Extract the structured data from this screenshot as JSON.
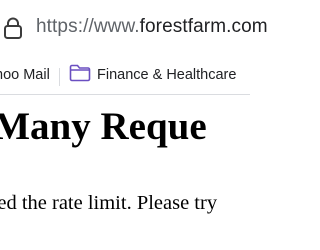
{
  "address_bar": {
    "prefix": "https://www.",
    "domain": "forestfarm.com"
  },
  "bookmarks": [
    {
      "label": "hoo Mail"
    },
    {
      "label": "Finance & Healthcare"
    }
  ],
  "page": {
    "heading": "o Many Reque",
    "message": "eded the rate limit. Please try"
  }
}
